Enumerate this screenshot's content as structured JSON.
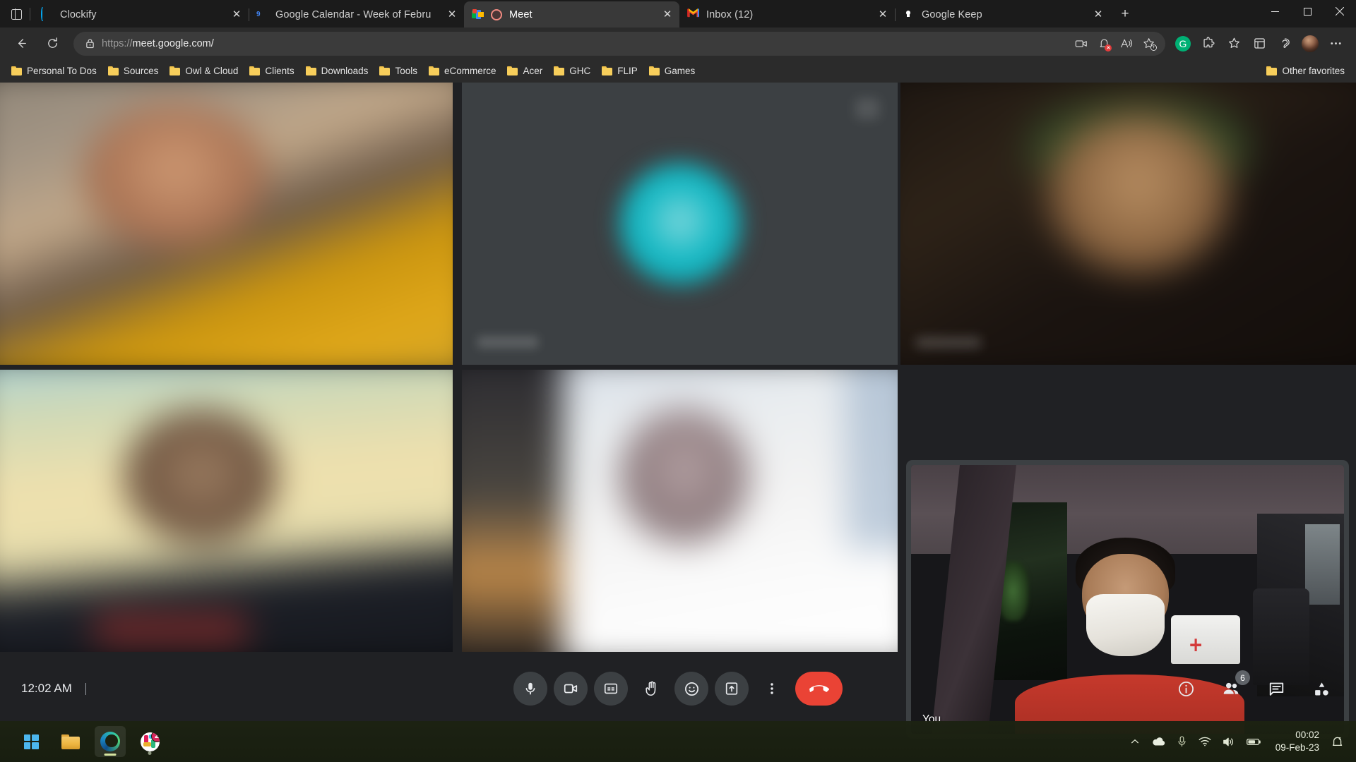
{
  "browser": {
    "tabs": [
      {
        "title": "Clockify",
        "favicon": "clockify-icon",
        "active": false
      },
      {
        "title": "Google Calendar - Week of Febru",
        "favicon": "google-calendar-icon",
        "active": false
      },
      {
        "title": "Meet",
        "favicon": "google-meet-icon",
        "active": true,
        "media_indicator": "microphone-active-indicator"
      },
      {
        "title": "Inbox (12)",
        "favicon": "gmail-icon",
        "active": false
      },
      {
        "title": "Google Keep",
        "favicon": "google-keep-icon",
        "active": false
      }
    ],
    "new_tab_label": "+",
    "window_controls": {
      "minimize": "minimize-button",
      "maximize": "maximize-button",
      "close": "close-button"
    },
    "address_bar": {
      "scheme": "https://",
      "host": "meet.google.com/",
      "full_url": "https://meet.google.com/",
      "security": "lock-icon"
    },
    "nav_icons": [
      "back-icon",
      "refresh-icon"
    ],
    "omnibox_icons": [
      "camera-icon",
      "notification-bell-icon",
      "read-aloud-icon",
      "add-favorite-icon"
    ],
    "toolbar_icons": [
      "grammarly-avatar",
      "extensions-icon",
      "favorites-icon",
      "collections-icon",
      "browser-essentials-icon",
      "profile-avatar",
      "settings-more-icon"
    ],
    "grammarly_letter": "G",
    "bookmarks": [
      "Personal To Dos",
      "Sources",
      "Owl & Cloud",
      "Clients",
      "Downloads",
      "Tools",
      "eCommerce",
      "Acer",
      "GHC",
      "FLIP",
      "Games"
    ],
    "other_favorites": "Other favorites"
  },
  "meet": {
    "participants": [
      {
        "id": "tile-1",
        "name": "",
        "video": true
      },
      {
        "id": "tile-2",
        "name": "",
        "video": false,
        "avatar_color": "#16b9c4"
      },
      {
        "id": "tile-3",
        "name": "",
        "video": true
      },
      {
        "id": "tile-4",
        "name": "",
        "video": true
      },
      {
        "id": "tile-5",
        "name": "",
        "video": true
      }
    ],
    "self_view": {
      "label": "You"
    },
    "time": "12:02 AM",
    "controls": [
      {
        "name": "microphone-button",
        "icon": "microphone-icon"
      },
      {
        "name": "camera-button",
        "icon": "video-camera-icon"
      },
      {
        "name": "captions-button",
        "icon": "closed-captions-icon"
      },
      {
        "name": "raise-hand-button",
        "icon": "raised-hand-icon"
      },
      {
        "name": "reactions-button",
        "icon": "emoji-smiley-icon"
      },
      {
        "name": "present-screen-button",
        "icon": "present-screen-icon"
      },
      {
        "name": "more-options-button",
        "icon": "three-dots-vertical-icon"
      },
      {
        "name": "end-call-button",
        "icon": "end-call-icon"
      }
    ],
    "right_controls": [
      {
        "name": "meeting-details-button",
        "icon": "info-circle-icon",
        "badge": ""
      },
      {
        "name": "show-everyone-button",
        "icon": "people-icon",
        "badge": "6"
      },
      {
        "name": "chat-button",
        "icon": "chat-bubble-icon",
        "badge": ""
      },
      {
        "name": "activities-button",
        "icon": "activities-shapes-icon",
        "badge": ""
      }
    ],
    "participant_count": "6"
  },
  "taskbar": {
    "apps": [
      {
        "name": "start-button",
        "icon": "windows-logo-icon",
        "badge": ""
      },
      {
        "name": "file-explorer-button",
        "icon": "file-explorer-icon",
        "badge": ""
      },
      {
        "name": "edge-browser-button",
        "icon": "microsoft-edge-icon",
        "badge": "",
        "active": true
      },
      {
        "name": "slack-button",
        "icon": "slack-icon",
        "badge": "2"
      }
    ],
    "tray": [
      "show-hidden-icons-chevron",
      "onedrive-cloud-icon",
      "microphone-icon",
      "wifi-icon",
      "volume-icon",
      "battery-icon"
    ],
    "clock_time": "00:02",
    "clock_date": "09-Feb-23",
    "notification_icon": "notifications-silent-bell-icon"
  },
  "colors": {
    "accent_red": "#ea4335",
    "tile_bg": "#3c4043",
    "app_bg": "#202124",
    "avatar_teal": "#16b9c4",
    "badge_grey": "#5f6368"
  }
}
